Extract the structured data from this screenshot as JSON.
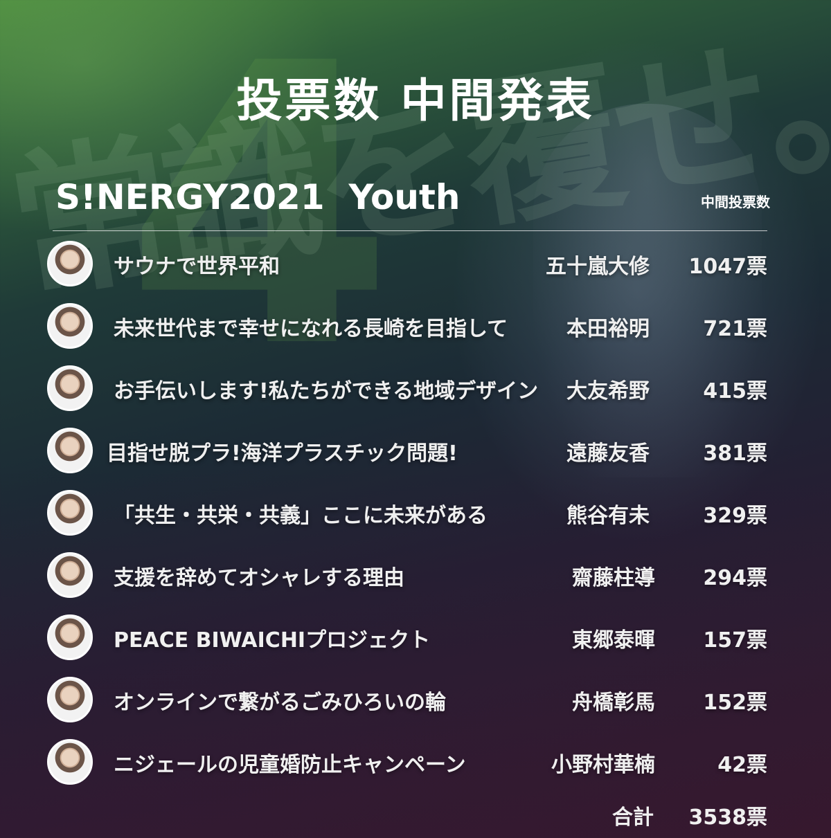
{
  "header": {
    "title": "投票数 中間発表",
    "background_slogan": "常識を覆せ。",
    "section_title": "S!NERGY2021  Youth",
    "column_label": "中間投票数"
  },
  "ranking": [
    {
      "project": "サウナで世界平和",
      "presenter": "五十嵐大修",
      "votes": "1047票"
    },
    {
      "project": "未来世代まで幸せになれる長崎を目指して",
      "presenter": "本田裕明",
      "votes": "721票"
    },
    {
      "project": "お手伝いします!私たちができる地域デザイン",
      "presenter": "大友希野",
      "votes": "415票"
    },
    {
      "project": "目指せ脱プラ!海洋プラスチック問題!",
      "presenter": "遠藤友香",
      "votes": "381票"
    },
    {
      "project": "「共生・共栄・共義」ここに未来がある",
      "presenter": "熊谷有未",
      "votes": "329票"
    },
    {
      "project": "支援を辞めてオシャレする理由",
      "presenter": "齋藤柱導",
      "votes": "294票"
    },
    {
      "project": "PEACE BIWAICHIプロジェクト",
      "presenter": "東郷泰暉",
      "votes": "157票"
    },
    {
      "project": "オンラインで繋がるごみひろいの輪",
      "presenter": "舟橋彰馬",
      "votes": "152票"
    },
    {
      "project": "ニジェールの児童婚防止キャンペーン",
      "presenter": "小野村華楠",
      "votes": "42票"
    }
  ],
  "total": {
    "label": "合計",
    "votes": "3538票"
  },
  "colors": {
    "background_top": "#4c8c3e",
    "background_bottom": "#331a2c",
    "text": "#f0f0f0"
  }
}
